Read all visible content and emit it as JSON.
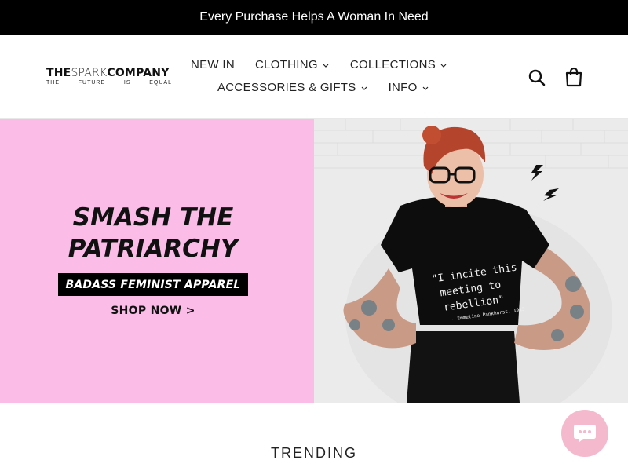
{
  "announcement": {
    "text": "Every Purchase Helps A Woman In Need"
  },
  "logo": {
    "line1_bold_a": "THE",
    "line1_thin": "SPARK",
    "line1_bold_b": "COMPANY",
    "tagline": [
      "THE",
      "FUTURE",
      "IS",
      "EQUAL"
    ]
  },
  "nav": {
    "row1": [
      {
        "label": "NEW IN",
        "dropdown": false
      },
      {
        "label": "CLOTHING",
        "dropdown": true
      },
      {
        "label": "COLLECTIONS",
        "dropdown": true
      }
    ],
    "row2": [
      {
        "label": "ACCESSORIES & GIFTS",
        "dropdown": true
      },
      {
        "label": "INFO",
        "dropdown": true
      }
    ]
  },
  "header_icons": {
    "search": "search-icon",
    "cart": "cart-icon"
  },
  "hero": {
    "title_line1": "SMASH THE",
    "title_line2": "PATRIARCHY",
    "tagline": "BADASS FEMINIST APPAREL",
    "cta": "SHOP NOW >",
    "bg_color": "#fbbde8",
    "shirt_text": [
      "\"I incite this",
      "meeting to",
      "rebellion\""
    ],
    "shirt_attribution": "- Emmeline Pankhurst, 1913"
  },
  "section": {
    "trending": "TRENDING"
  },
  "chat": {
    "icon": "chat-icon",
    "color": "#f4b9cc"
  }
}
